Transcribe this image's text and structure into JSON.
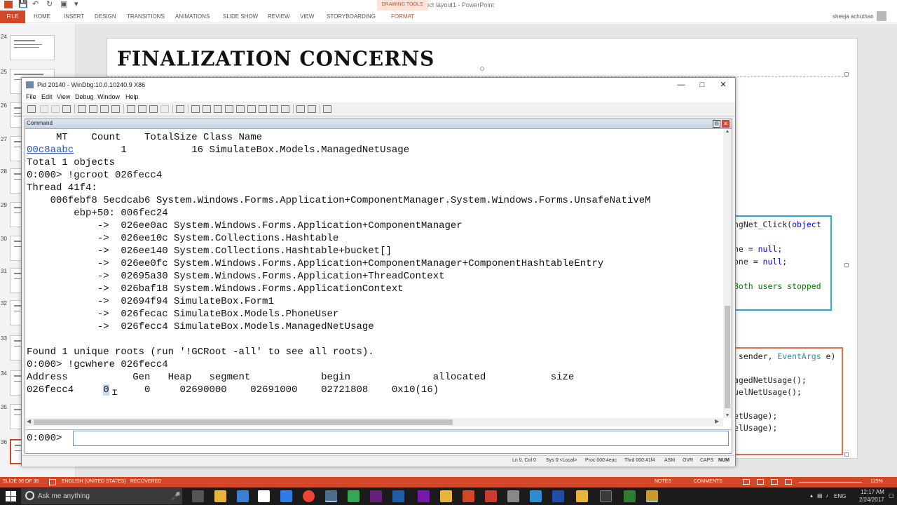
{
  "powerpoint": {
    "doc_title": "NET object layout1 - PowerPoint",
    "contextual_group": "DRAWING TOOLS",
    "tabs": [
      "FILE",
      "HOME",
      "INSERT",
      "DESIGN",
      "TRANSITIONS",
      "ANIMATIONS",
      "SLIDE SHOW",
      "REVIEW",
      "VIEW",
      "STORYBOARDING",
      "FORMAT"
    ],
    "user_name": "sheeja achuthan",
    "slide_title": "Finalization Concerns",
    "thumbnails": [
      "24",
      "25",
      "26",
      "27",
      "28",
      "29",
      "30",
      "31",
      "32",
      "33",
      "34",
      "35",
      "36"
    ],
    "code_box_1": [
      {
        "parts": [
          {
            "t": "ngNet_Click(",
            "c": ""
          },
          {
            "t": "object",
            "c": "kw"
          }
        ]
      },
      {
        "parts": [
          {
            "t": "",
            "c": ""
          }
        ]
      },
      {
        "parts": [
          {
            "t": "ne = ",
            "c": ""
          },
          {
            "t": "null",
            "c": "kw"
          },
          {
            "t": ";",
            "c": ""
          }
        ]
      },
      {
        "parts": [
          {
            "t": "one = ",
            "c": ""
          },
          {
            "t": "null",
            "c": "kw"
          },
          {
            "t": ";",
            "c": ""
          }
        ]
      },
      {
        "parts": [
          {
            "t": "",
            "c": ""
          }
        ]
      },
      {
        "parts": [
          {
            "t": "Both users stopped",
            "c": "cm"
          }
        ]
      }
    ],
    "code_box_2": [
      {
        "parts": [
          {
            "t": " sender, ",
            "c": ""
          },
          {
            "t": "EventArgs",
            "c": "ty"
          },
          {
            "t": " e)",
            "c": ""
          }
        ]
      },
      {
        "parts": [
          {
            "t": "",
            "c": ""
          }
        ]
      },
      {
        "parts": [
          {
            "t": "agedNetUsage();",
            "c": ""
          }
        ]
      },
      {
        "parts": [
          {
            "t": "uelNetUsage();",
            "c": ""
          }
        ]
      },
      {
        "parts": [
          {
            "t": "",
            "c": ""
          }
        ]
      },
      {
        "parts": [
          {
            "t": "etUsage);",
            "c": ""
          }
        ]
      },
      {
        "parts": [
          {
            "t": "elUsage);",
            "c": ""
          }
        ]
      }
    ],
    "status": {
      "slide": "SLIDE 36 OF 36",
      "language": "ENGLISH (UNITED STATES)",
      "recovered": "RECOVERED",
      "notes": "NOTES",
      "comments": "COMMENTS",
      "zoom": "125%"
    }
  },
  "windbg": {
    "title": "Pid 20140 - WinDbg:10.0.10240.9 X86",
    "menu": [
      "File",
      "Edit",
      "View",
      "Debug",
      "Window",
      "Help"
    ],
    "command_window_label": "Command",
    "output_lines": [
      "     MT    Count    TotalSize Class Name",
      "00c8aabc        1           16 SimulateBox.Models.ManagedNetUsage",
      "Total 1 objects",
      "0:000> !gcroot 026fecc4",
      "Thread 41f4:",
      "    006febf8 5ecdcab6 System.Windows.Forms.Application+ComponentManager.System.Windows.Forms.UnsafeNativeM",
      "        ebp+50: 006fec24",
      "            ->  026ee0ac System.Windows.Forms.Application+ComponentManager",
      "            ->  026ee10c System.Collections.Hashtable",
      "            ->  026ee140 System.Collections.Hashtable+bucket[]",
      "            ->  026ee0fc System.Windows.Forms.Application+ComponentManager+ComponentHashtableEntry",
      "            ->  02695a30 System.Windows.Forms.Application+ThreadContext",
      "            ->  026baf18 System.Windows.Forms.ApplicationContext",
      "            ->  02694f94 SimulateBox.Form1",
      "            ->  026fecac SimulateBox.Models.PhoneUser",
      "            ->  026fecc4 SimulateBox.Models.ManagedNetUsage",
      "",
      "Found 1 unique roots (run '!GCRoot -all' to see all roots).",
      "0:000> !gcwhere 026fecc4",
      "Address           Gen   Heap   segment            begin              allocated           size",
      "026fecc4     0      0     02690000    02691000    02721808    0x10(16)"
    ],
    "mt_link": "00c8aabc",
    "gcwhere_row": {
      "address": "026fecc4",
      "selected_gen": "0",
      "rest": "      0     02690000    02691000    02721808    0x10(16)"
    },
    "prompt": "0:000>",
    "input_value": "",
    "status": [
      "Ln 0, Col 0",
      "Sys 0:<Local>",
      "Proc 000:4eac",
      "Thrd 000:41f4",
      "ASM",
      "OVR",
      "CAPS",
      "NUM"
    ]
  },
  "taskbar": {
    "search_placeholder": "Ask me anything",
    "language": "ENG",
    "time": "12:17 AM",
    "date": "2/24/2017"
  },
  "colors": {
    "accent": "#d24726",
    "windbg_link": "#2b55c0",
    "selection": "#c5d9f1",
    "code_keyword": "#0000ff",
    "code_type": "#2b91af",
    "code_comment": "#008000"
  }
}
